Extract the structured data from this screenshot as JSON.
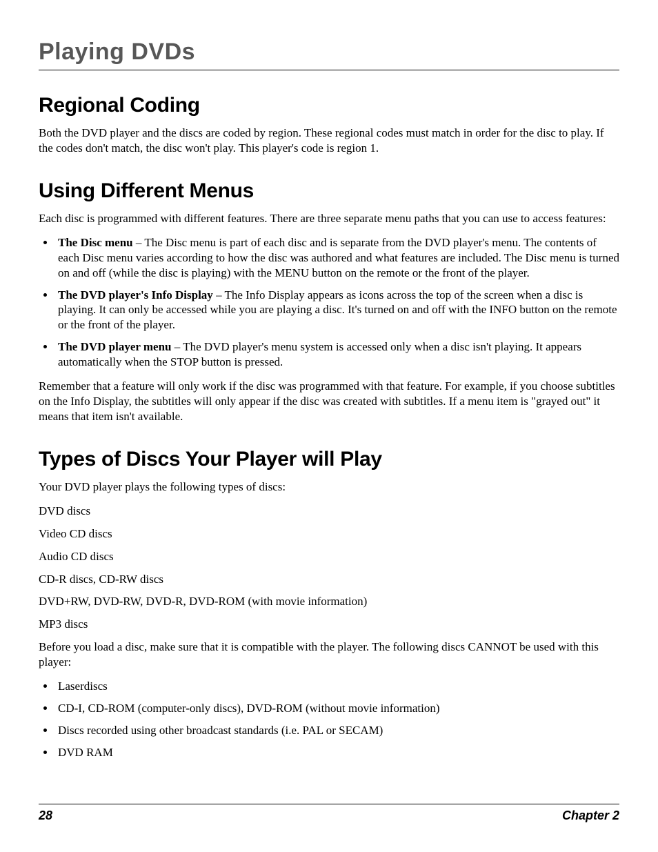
{
  "header": {
    "chapter_title": "Playing DVDs"
  },
  "sections": {
    "regional": {
      "heading": "Regional Coding",
      "body": "Both the DVD player and the discs are coded by region. These regional codes must match in order for the disc to play. If the codes don't match, the disc won't play. This player's code is region 1."
    },
    "menus": {
      "heading": "Using Different Menus",
      "intro": "Each disc is programmed with different features. There are three separate menu paths that you can use to access features:",
      "items": [
        {
          "lead": "The Disc menu",
          "rest": " – The Disc menu is part of each disc and is separate from the DVD player's menu. The contents of each Disc menu varies according to how the disc was authored and what features are included. The Disc menu is turned on and off (while the disc is playing) with the MENU button on the remote or the front of the player."
        },
        {
          "lead": "The DVD player's Info Display",
          "rest": " – The Info Display appears as icons across the top of the screen when a disc is playing. It can only be accessed while you are playing a disc. It's turned on and off with the INFO button on the remote or the front of the player."
        },
        {
          "lead": "The DVD player menu",
          "rest": " – The DVD player's menu system is accessed only when a disc isn't playing. It appears automatically when the STOP button is pressed."
        }
      ],
      "outro": "Remember that a feature will only work if the disc was programmed with that feature. For example, if you choose subtitles on the Info Display, the subtitles will only appear if the disc was created with subtitles. If a menu item is \"grayed out\" it means that item isn't available."
    },
    "types": {
      "heading": "Types of Discs Your Player will Play",
      "intro": "Your DVD player plays the following types of discs:",
      "compatible": [
        "DVD discs",
        "Video CD discs",
        "Audio CD discs",
        "CD-R discs, CD-RW discs",
        "DVD+RW, DVD-RW, DVD-R, DVD-ROM (with movie information)",
        "MP3 discs"
      ],
      "incompat_intro": "Before you load a disc, make sure that it is compatible with the player. The following discs CANNOT be used with this player:",
      "incompatible": [
        "Laserdiscs",
        "CD-I, CD-ROM (computer-only discs), DVD-ROM (without movie information)",
        "Discs recorded using other broadcast standards (i.e. PAL or SECAM)",
        "DVD RAM"
      ]
    }
  },
  "footer": {
    "page_number": "28",
    "chapter_label": "Chapter 2"
  }
}
